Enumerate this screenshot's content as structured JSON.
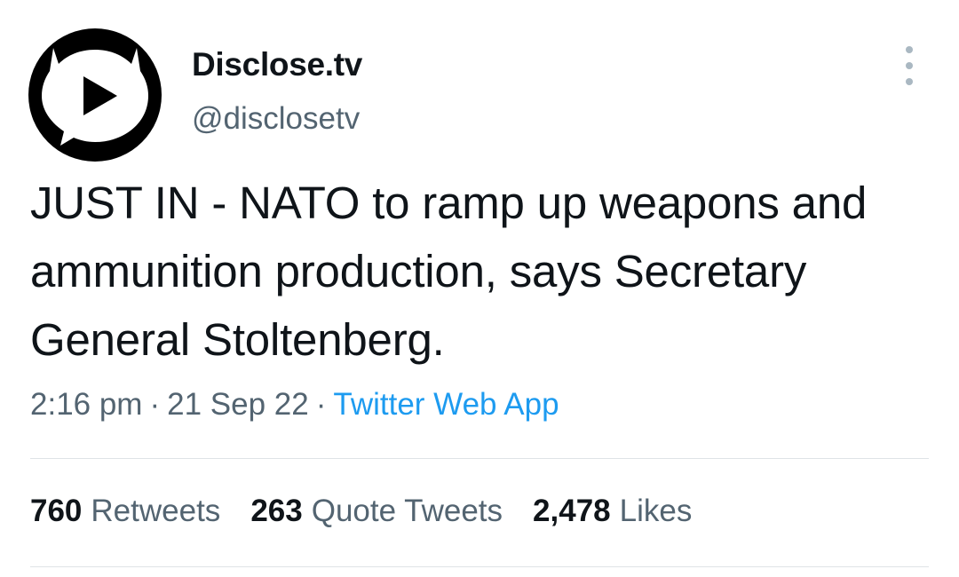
{
  "author": {
    "display_name": "Disclose.tv",
    "handle": "@disclosetv",
    "avatar_icon": "disclose-play-bubble-icon"
  },
  "tweet": {
    "text": "JUST IN - NATO to ramp up weapons and ammunition production, says Secretary General Stoltenberg.",
    "time": "2:16 pm",
    "date": "21 Sep 22",
    "separator": "·",
    "source": "Twitter Web App"
  },
  "stats": {
    "retweets_count": "760",
    "retweets_label": "Retweets",
    "quotes_count": "263",
    "quotes_label": "Quote Tweets",
    "likes_count": "2,478",
    "likes_label": "Likes"
  },
  "menu": {
    "icon": "more-vertical-icon"
  },
  "colors": {
    "text_primary": "#0f1419",
    "text_secondary": "#536471",
    "link": "#1d9bf0",
    "divider": "#dfe3e6"
  }
}
